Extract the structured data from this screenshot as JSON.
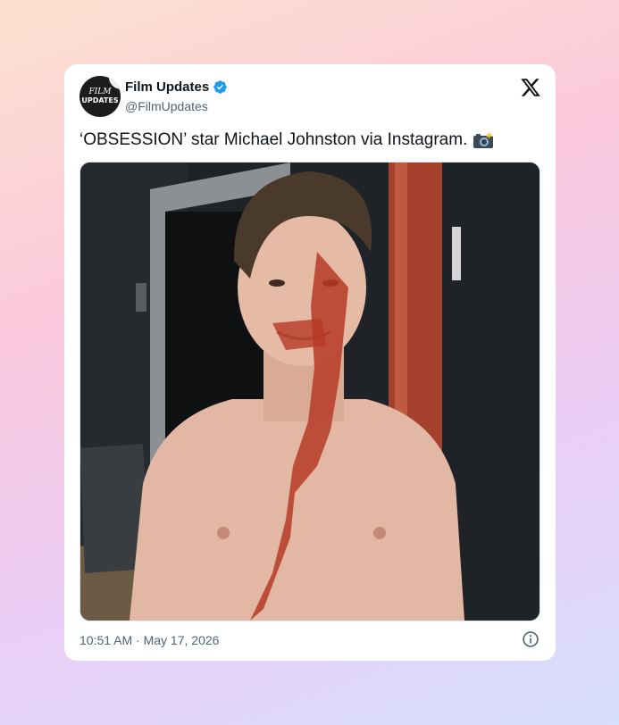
{
  "tweet": {
    "avatar": {
      "line1": "FILM",
      "line2": "UPDATES"
    },
    "display_name": "Film Updates",
    "verified": true,
    "handle": "@FilmUpdates",
    "text": "‘OBSESSION’ star Michael Johnston via Instagram.",
    "text_emoji": "camera-flash-icon",
    "media": {
      "description_icon": "photo-icon"
    },
    "timestamp": "10:51 AM · May 17, 2026",
    "platform_icon": "x-logo-icon",
    "info_icon": "info-icon"
  },
  "colors": {
    "verified_blue": "#1d9bf0",
    "text_primary": "#0f1419",
    "text_secondary": "#536471",
    "card_bg": "#ffffff"
  }
}
